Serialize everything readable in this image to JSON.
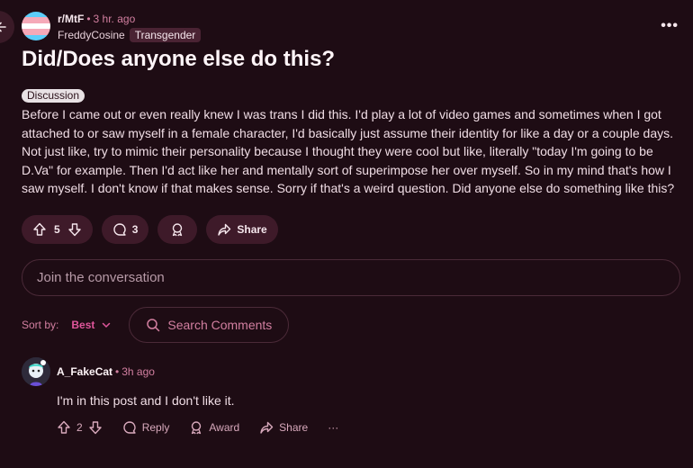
{
  "colors": {
    "background": "#1e0c14",
    "accent": "#e0569b",
    "pill": "#3e1a29",
    "trans_blue": "#5bcefa",
    "trans_pink": "#f5a9b8",
    "trans_white": "#ffffff"
  },
  "header": {
    "subreddit": "r/MtF",
    "time": "3 hr. ago",
    "author": "FreddyCosine",
    "author_flair": "Transgender",
    "more_icon": "ellipsis-icon",
    "back_icon": "arrow-left-icon"
  },
  "post": {
    "title": "Did/Does anyone else do this?",
    "flair": "Discussion",
    "body": "Before I came out or even really knew I was trans I did this. I'd play a lot of video games and sometimes when I got attached to or saw myself in a female character, I'd basically just assume their identity for like a day or a couple days. Not just like, try to mimic their personality because I thought they were cool but like, literally \"today I'm going to be D.Va\" for example. Then I'd act like her and mentally sort of superimpose her over myself. So in my mind that's how I saw myself. I don't know if that makes sense. Sorry if that's a weird question. Did anyone else do something like this?"
  },
  "actions": {
    "votes": "5",
    "comments": "3",
    "share_label": "Share"
  },
  "comment_box": {
    "placeholder": "Join the conversation"
  },
  "sort": {
    "label": "Sort by:",
    "value": "Best",
    "search_label": "Search Comments"
  },
  "comments": [
    {
      "author": "A_FakeCat",
      "time": "3h ago",
      "text": "I'm in this post and I don't like it.",
      "votes": "2",
      "reply_label": "Reply",
      "award_label": "Award",
      "share_label": "Share",
      "more_label": "···"
    }
  ]
}
